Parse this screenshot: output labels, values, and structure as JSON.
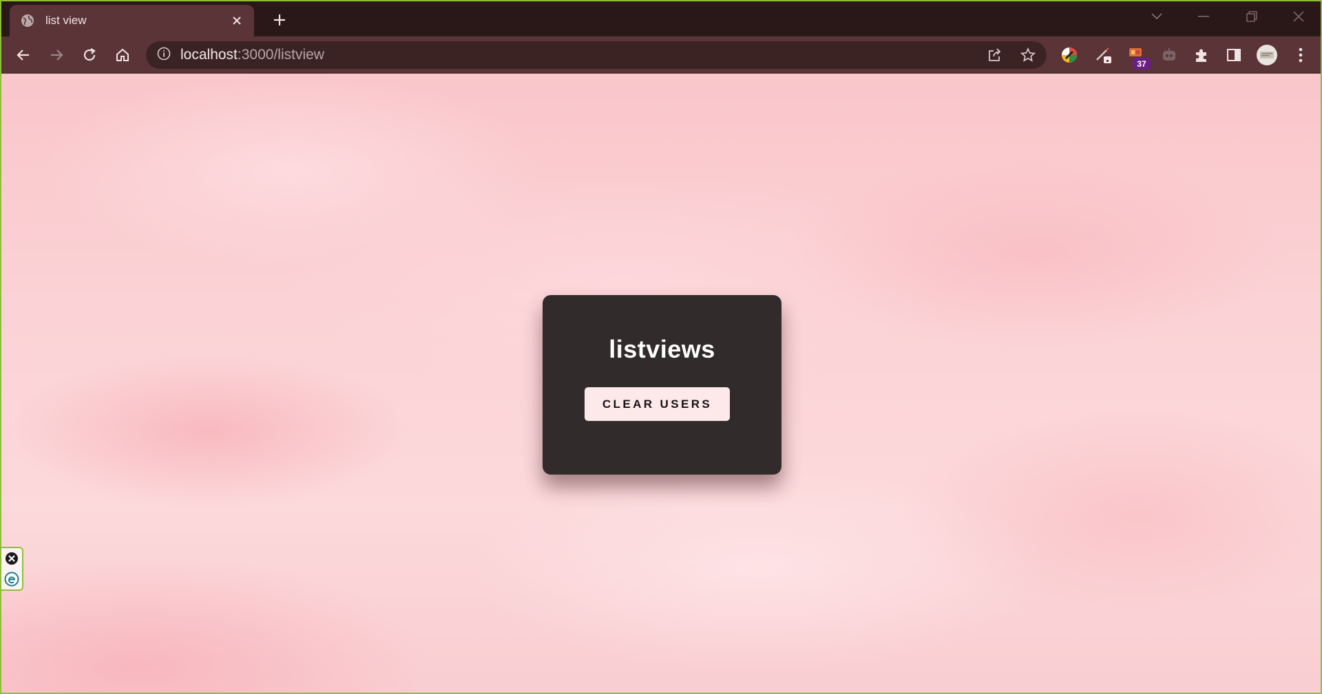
{
  "browser": {
    "tab": {
      "title": "list view",
      "favicon": "globe-icon"
    },
    "url": {
      "host": "localhost",
      "path": ":3000/listview"
    },
    "badges": {
      "extension_count": "37"
    }
  },
  "card": {
    "title": "listviews",
    "clear_button_label": "CLEAR USERS"
  },
  "theme": {
    "card_bg": "#322b2b",
    "button_bg": "#fde9ea",
    "page_bg": "#fbd4d6",
    "browser_frame": "#5a3436"
  }
}
